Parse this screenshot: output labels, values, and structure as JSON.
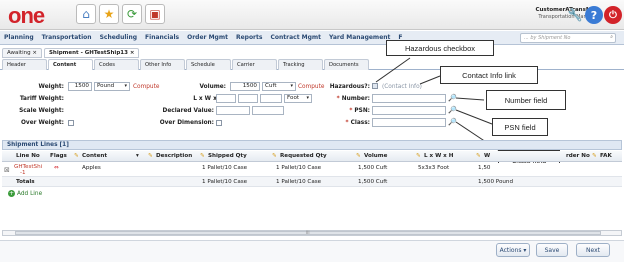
{
  "header": {
    "logo": "one",
    "user_name": "CustomerATransMgr",
    "user_role": "Transportation Manager",
    "search_placeholder": "... by Shipment No"
  },
  "menu": [
    "Planning",
    "Transportation",
    "Scheduling",
    "Financials",
    "Order Mgmt",
    "Reports",
    "Contract Mgmt",
    "Yard Management",
    "F"
  ],
  "doc_tabs": [
    "Awaiting ×",
    "Shipment - GHTestShip13 ×"
  ],
  "sub_tabs": [
    "Header",
    "Content",
    "Codes",
    "Other Info",
    "Schedule",
    "Carrier",
    "Tracking",
    "Documents"
  ],
  "form": {
    "weight_label": "Weight:",
    "weight_value": "1500",
    "weight_unit": "Pound",
    "compute": "Compute",
    "tariff_label": "Tariff Weight:",
    "scale_label": "Scale Weight:",
    "over_weight_label": "Over Weight:",
    "volume_label": "Volume:",
    "volume_value": "1500",
    "volume_unit": "Cuft",
    "lwh_label": "L x W x H:",
    "lwh_unit": "Foot",
    "declared_label": "Declared Value:",
    "overdim_label": "Over Dimension:",
    "hazardous_label": "Hazardous?:",
    "contact_info": "(Contact Info)",
    "number_label": "Number:",
    "psn_label": "PSN:",
    "class_label": "Class:",
    "req": "*"
  },
  "callouts": {
    "hazardous": "Hazardous checkbox",
    "contact": "Contact Info link",
    "number": "Number field",
    "psn": "PSN field",
    "class": "Class field"
  },
  "grid": {
    "title": "Shipment Lines [1]",
    "columns": [
      "Line No",
      "Flags",
      "Content",
      "Description",
      "Shipped Qty",
      "Requested Qty",
      "Volume",
      "L x W x H",
      "W",
      "rder No",
      "FAK"
    ],
    "row": {
      "line_no": "GHTestShi",
      "line_no2": "-1",
      "content": "Apples",
      "shipped": "1 Pallet/10 Case",
      "requested": "1 Pallet/10 Case",
      "volume": "1,500 Cuft",
      "lwh": "5x3x3 Foot",
      "weight": "1,50"
    },
    "totals": {
      "label": "Totals",
      "shipped": "1 Pallet/10 Case",
      "requested": "1 Pallet/10 Case",
      "volume": "1,500 Cuft",
      "weight": "1,500 Pound"
    },
    "add_line": "Add Line",
    "scroll_mark": "III"
  },
  "footer": {
    "actions": "Actions ▾",
    "save": "Save",
    "next": "Next"
  }
}
